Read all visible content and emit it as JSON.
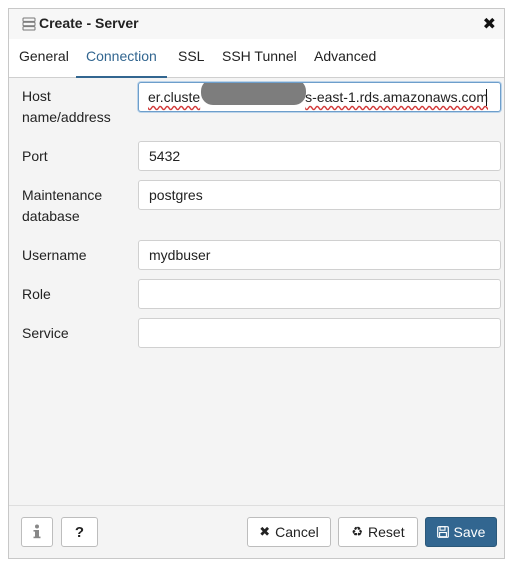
{
  "dialog": {
    "title": "Create - Server",
    "close_symbol": "✖",
    "icon": "server-icon"
  },
  "tabs": [
    {
      "label": "General",
      "active": false
    },
    {
      "label": "Connection",
      "active": true
    },
    {
      "label": "SSL",
      "active": false
    },
    {
      "label": "SSH Tunnel",
      "active": false
    },
    {
      "label": "Advanced",
      "active": false
    }
  ],
  "form": {
    "host": {
      "label_line1": "Host",
      "label_line2": "name/address",
      "value_prefix": "er.cluste",
      "value_suffix": "s-east-1.rds.amazonaws.com"
    },
    "port": {
      "label": "Port",
      "value": "5432"
    },
    "maintenance_db": {
      "label_line1": "Maintenance",
      "label_line2": "database",
      "value": "postgres"
    },
    "username": {
      "label": "Username",
      "value": "mydbuser"
    },
    "role": {
      "label": "Role",
      "value": ""
    },
    "service": {
      "label": "Service",
      "value": ""
    }
  },
  "footer": {
    "info_icon": "info-icon",
    "help_label": "?",
    "cancel_label": "Cancel",
    "cancel_icon": "✖",
    "reset_label": "Reset",
    "reset_icon": "♻",
    "save_label": "Save",
    "save_icon": "save-icon"
  },
  "colors": {
    "accent": "#326690",
    "dialog_bg": "#f4f4f4",
    "spellcheck_underline": "#d23838"
  }
}
